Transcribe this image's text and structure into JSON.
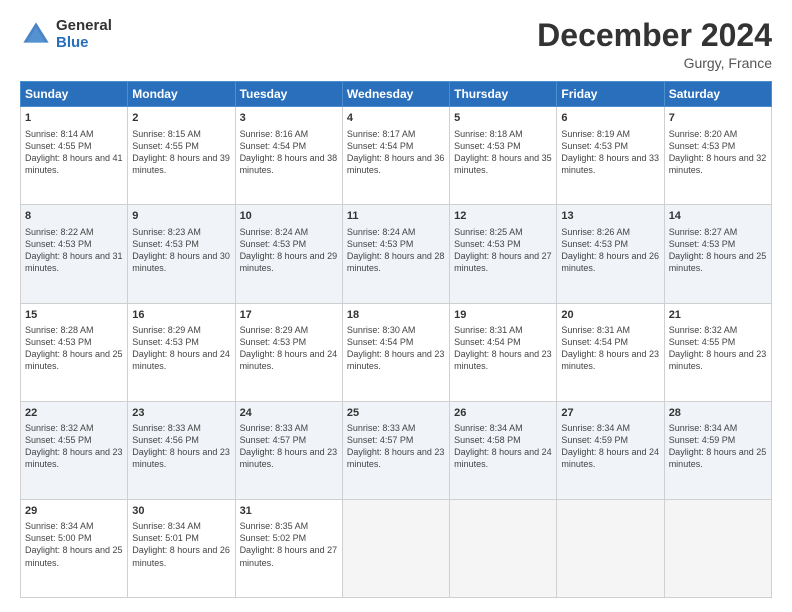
{
  "logo": {
    "general": "General",
    "blue": "Blue"
  },
  "title": "December 2024",
  "subtitle": "Gurgy, France",
  "weekdays": [
    "Sunday",
    "Monday",
    "Tuesday",
    "Wednesday",
    "Thursday",
    "Friday",
    "Saturday"
  ],
  "weeks": [
    [
      {
        "day": "1",
        "sunrise": "Sunrise: 8:14 AM",
        "sunset": "Sunset: 4:55 PM",
        "daylight": "Daylight: 8 hours and 41 minutes."
      },
      {
        "day": "2",
        "sunrise": "Sunrise: 8:15 AM",
        "sunset": "Sunset: 4:55 PM",
        "daylight": "Daylight: 8 hours and 39 minutes."
      },
      {
        "day": "3",
        "sunrise": "Sunrise: 8:16 AM",
        "sunset": "Sunset: 4:54 PM",
        "daylight": "Daylight: 8 hours and 38 minutes."
      },
      {
        "day": "4",
        "sunrise": "Sunrise: 8:17 AM",
        "sunset": "Sunset: 4:54 PM",
        "daylight": "Daylight: 8 hours and 36 minutes."
      },
      {
        "day": "5",
        "sunrise": "Sunrise: 8:18 AM",
        "sunset": "Sunset: 4:53 PM",
        "daylight": "Daylight: 8 hours and 35 minutes."
      },
      {
        "day": "6",
        "sunrise": "Sunrise: 8:19 AM",
        "sunset": "Sunset: 4:53 PM",
        "daylight": "Daylight: 8 hours and 33 minutes."
      },
      {
        "day": "7",
        "sunrise": "Sunrise: 8:20 AM",
        "sunset": "Sunset: 4:53 PM",
        "daylight": "Daylight: 8 hours and 32 minutes."
      }
    ],
    [
      {
        "day": "8",
        "sunrise": "Sunrise: 8:22 AM",
        "sunset": "Sunset: 4:53 PM",
        "daylight": "Daylight: 8 hours and 31 minutes."
      },
      {
        "day": "9",
        "sunrise": "Sunrise: 8:23 AM",
        "sunset": "Sunset: 4:53 PM",
        "daylight": "Daylight: 8 hours and 30 minutes."
      },
      {
        "day": "10",
        "sunrise": "Sunrise: 8:24 AM",
        "sunset": "Sunset: 4:53 PM",
        "daylight": "Daylight: 8 hours and 29 minutes."
      },
      {
        "day": "11",
        "sunrise": "Sunrise: 8:24 AM",
        "sunset": "Sunset: 4:53 PM",
        "daylight": "Daylight: 8 hours and 28 minutes."
      },
      {
        "day": "12",
        "sunrise": "Sunrise: 8:25 AM",
        "sunset": "Sunset: 4:53 PM",
        "daylight": "Daylight: 8 hours and 27 minutes."
      },
      {
        "day": "13",
        "sunrise": "Sunrise: 8:26 AM",
        "sunset": "Sunset: 4:53 PM",
        "daylight": "Daylight: 8 hours and 26 minutes."
      },
      {
        "day": "14",
        "sunrise": "Sunrise: 8:27 AM",
        "sunset": "Sunset: 4:53 PM",
        "daylight": "Daylight: 8 hours and 25 minutes."
      }
    ],
    [
      {
        "day": "15",
        "sunrise": "Sunrise: 8:28 AM",
        "sunset": "Sunset: 4:53 PM",
        "daylight": "Daylight: 8 hours and 25 minutes."
      },
      {
        "day": "16",
        "sunrise": "Sunrise: 8:29 AM",
        "sunset": "Sunset: 4:53 PM",
        "daylight": "Daylight: 8 hours and 24 minutes."
      },
      {
        "day": "17",
        "sunrise": "Sunrise: 8:29 AM",
        "sunset": "Sunset: 4:53 PM",
        "daylight": "Daylight: 8 hours and 24 minutes."
      },
      {
        "day": "18",
        "sunrise": "Sunrise: 8:30 AM",
        "sunset": "Sunset: 4:54 PM",
        "daylight": "Daylight: 8 hours and 23 minutes."
      },
      {
        "day": "19",
        "sunrise": "Sunrise: 8:31 AM",
        "sunset": "Sunset: 4:54 PM",
        "daylight": "Daylight: 8 hours and 23 minutes."
      },
      {
        "day": "20",
        "sunrise": "Sunrise: 8:31 AM",
        "sunset": "Sunset: 4:54 PM",
        "daylight": "Daylight: 8 hours and 23 minutes."
      },
      {
        "day": "21",
        "sunrise": "Sunrise: 8:32 AM",
        "sunset": "Sunset: 4:55 PM",
        "daylight": "Daylight: 8 hours and 23 minutes."
      }
    ],
    [
      {
        "day": "22",
        "sunrise": "Sunrise: 8:32 AM",
        "sunset": "Sunset: 4:55 PM",
        "daylight": "Daylight: 8 hours and 23 minutes."
      },
      {
        "day": "23",
        "sunrise": "Sunrise: 8:33 AM",
        "sunset": "Sunset: 4:56 PM",
        "daylight": "Daylight: 8 hours and 23 minutes."
      },
      {
        "day": "24",
        "sunrise": "Sunrise: 8:33 AM",
        "sunset": "Sunset: 4:57 PM",
        "daylight": "Daylight: 8 hours and 23 minutes."
      },
      {
        "day": "25",
        "sunrise": "Sunrise: 8:33 AM",
        "sunset": "Sunset: 4:57 PM",
        "daylight": "Daylight: 8 hours and 23 minutes."
      },
      {
        "day": "26",
        "sunrise": "Sunrise: 8:34 AM",
        "sunset": "Sunset: 4:58 PM",
        "daylight": "Daylight: 8 hours and 24 minutes."
      },
      {
        "day": "27",
        "sunrise": "Sunrise: 8:34 AM",
        "sunset": "Sunset: 4:59 PM",
        "daylight": "Daylight: 8 hours and 24 minutes."
      },
      {
        "day": "28",
        "sunrise": "Sunrise: 8:34 AM",
        "sunset": "Sunset: 4:59 PM",
        "daylight": "Daylight: 8 hours and 25 minutes."
      }
    ],
    [
      {
        "day": "29",
        "sunrise": "Sunrise: 8:34 AM",
        "sunset": "Sunset: 5:00 PM",
        "daylight": "Daylight: 8 hours and 25 minutes."
      },
      {
        "day": "30",
        "sunrise": "Sunrise: 8:34 AM",
        "sunset": "Sunset: 5:01 PM",
        "daylight": "Daylight: 8 hours and 26 minutes."
      },
      {
        "day": "31",
        "sunrise": "Sunrise: 8:35 AM",
        "sunset": "Sunset: 5:02 PM",
        "daylight": "Daylight: 8 hours and 27 minutes."
      },
      null,
      null,
      null,
      null
    ]
  ]
}
